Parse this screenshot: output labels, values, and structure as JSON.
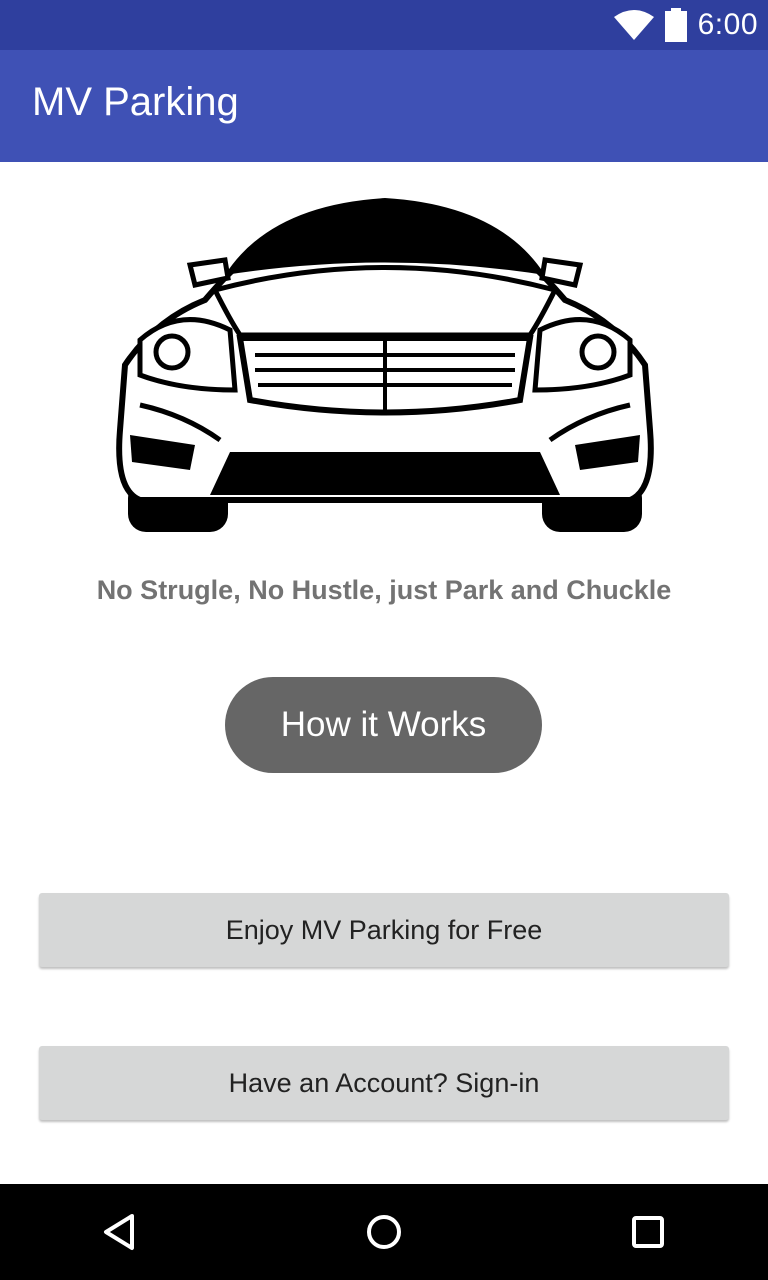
{
  "status_bar": {
    "time": "6:00",
    "icons": [
      "wifi-icon",
      "battery-icon"
    ]
  },
  "app_bar": {
    "title": "MV Parking"
  },
  "hero": {
    "image": "car-front-illustration"
  },
  "tagline": "No Strugle, No Hustle, just Park and Chuckle",
  "buttons": {
    "how_it_works": "How it Works",
    "free": "Enjoy MV Parking for Free",
    "signin": "Have an Account? Sign-in"
  },
  "nav_bar": {
    "icons": [
      "back-icon",
      "home-icon",
      "recent-apps-icon"
    ]
  },
  "colors": {
    "status_bar": "#2f3f9e",
    "app_bar": "#3f51b5",
    "how_button": "#666666",
    "wide_button": "#d6d7d7",
    "tagline": "#737373"
  }
}
